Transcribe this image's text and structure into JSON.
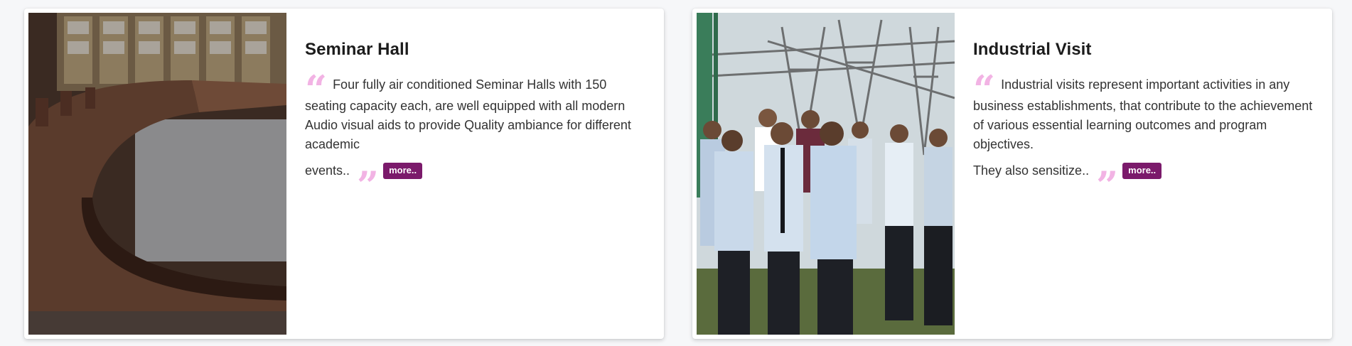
{
  "cards": [
    {
      "title": "Seminar Hall",
      "image_alt": "seminar-hall-photo",
      "text_main": "Four fully air conditioned Seminar Halls with 150 seating capacity each, are well equipped with all modern Audio visual aids to provide Quality ambiance for different academic",
      "text_tail": "events..",
      "more_label": "more.."
    },
    {
      "title": "Industrial Visit",
      "image_alt": "industrial-visit-photo",
      "text_main": "Industrial visits represent important activities in any business establishments, that contribute to the achievement of various essential learning outcomes and program objectives.",
      "text_tail": "They also sensitize..",
      "more_label": "more.."
    }
  ],
  "quote_open_glyph": "“",
  "quote_close_glyph": "”",
  "colors": {
    "accent": "#7b1a6b",
    "quote": "#f2b3e4",
    "title": "#1c1c1c",
    "text": "#333333"
  }
}
